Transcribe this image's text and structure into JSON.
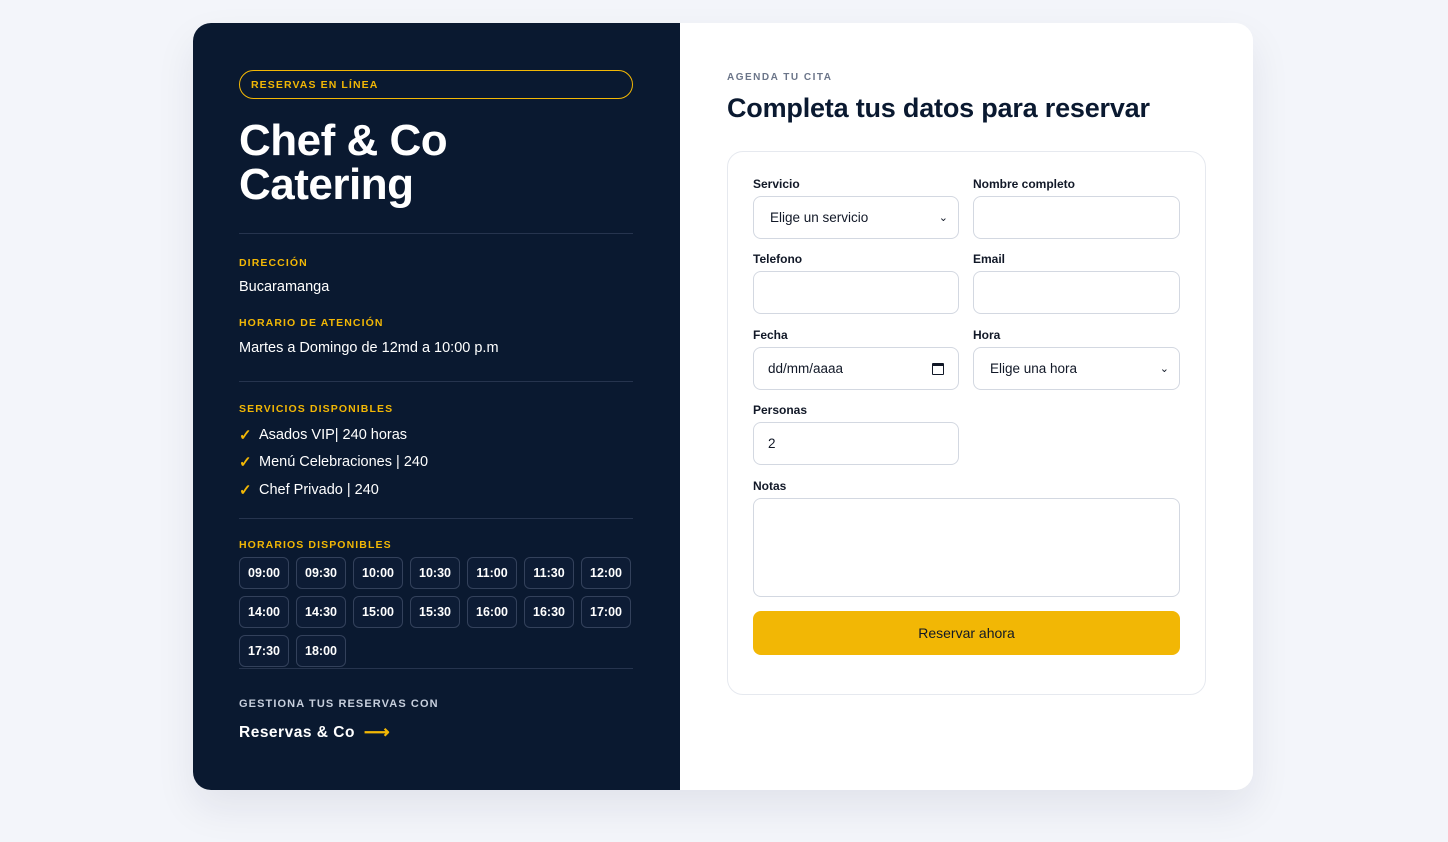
{
  "sidebar": {
    "badge": "RESERVAS EN LÍNEA",
    "brand_line1": "Chef & Co",
    "brand_line2": "Catering",
    "address_label": "DIRECCIÓN",
    "address_value": "Bucaramanga",
    "hours_label": "HORARIO DE ATENCIÓN",
    "hours_value": "Martes a Domingo de 12md a 10:00 p.m",
    "services_label": "SERVICIOS DISPONIBLES",
    "services": [
      {
        "icon": "check-icon",
        "check": "✓",
        "text": "Asados VIP| 240 horas"
      },
      {
        "icon": "check-icon",
        "check": "✓",
        "text": "Menú Celebraciones | 240"
      },
      {
        "icon": "check-icon",
        "check": "✓",
        "text": "Chef Privado | 240"
      }
    ],
    "times_label": "HORARIOS DISPONIBLES",
    "times": [
      "09:00",
      "09:30",
      "10:00",
      "10:30",
      "11:00",
      "11:30",
      "12:00",
      "14:00",
      "14:30",
      "15:00",
      "15:30",
      "16:00",
      "16:30",
      "17:00",
      "17:30",
      "18:00"
    ],
    "manage_label": "GESTIONA TUS RESERVAS CON",
    "manage_link": "Reservas & Co",
    "manage_arrow": "⟶"
  },
  "form": {
    "eyebrow": "AGENDA TU CITA",
    "heading": "Completa tus datos para reservar",
    "service_label": "Servicio",
    "service_value": "Elige un servicio",
    "name_label": "Nombre completo",
    "name_value": "",
    "phone_label": "Telefono",
    "phone_value": "",
    "email_label": "Email",
    "email_value": "",
    "date_label": "Fecha",
    "date_placeholder": "dd/mm/aaaa",
    "time_label": "Hora",
    "time_value": "Elige una hora",
    "people_label": "Personas",
    "people_value": "2",
    "notes_label": "Notas",
    "notes_value": "",
    "submit_label": "Reservar ahora",
    "chevron": "⌄"
  },
  "colors": {
    "sidebar_bg": "#0a1930",
    "accent": "#f2b705",
    "page_bg": "#f3f5fa"
  }
}
